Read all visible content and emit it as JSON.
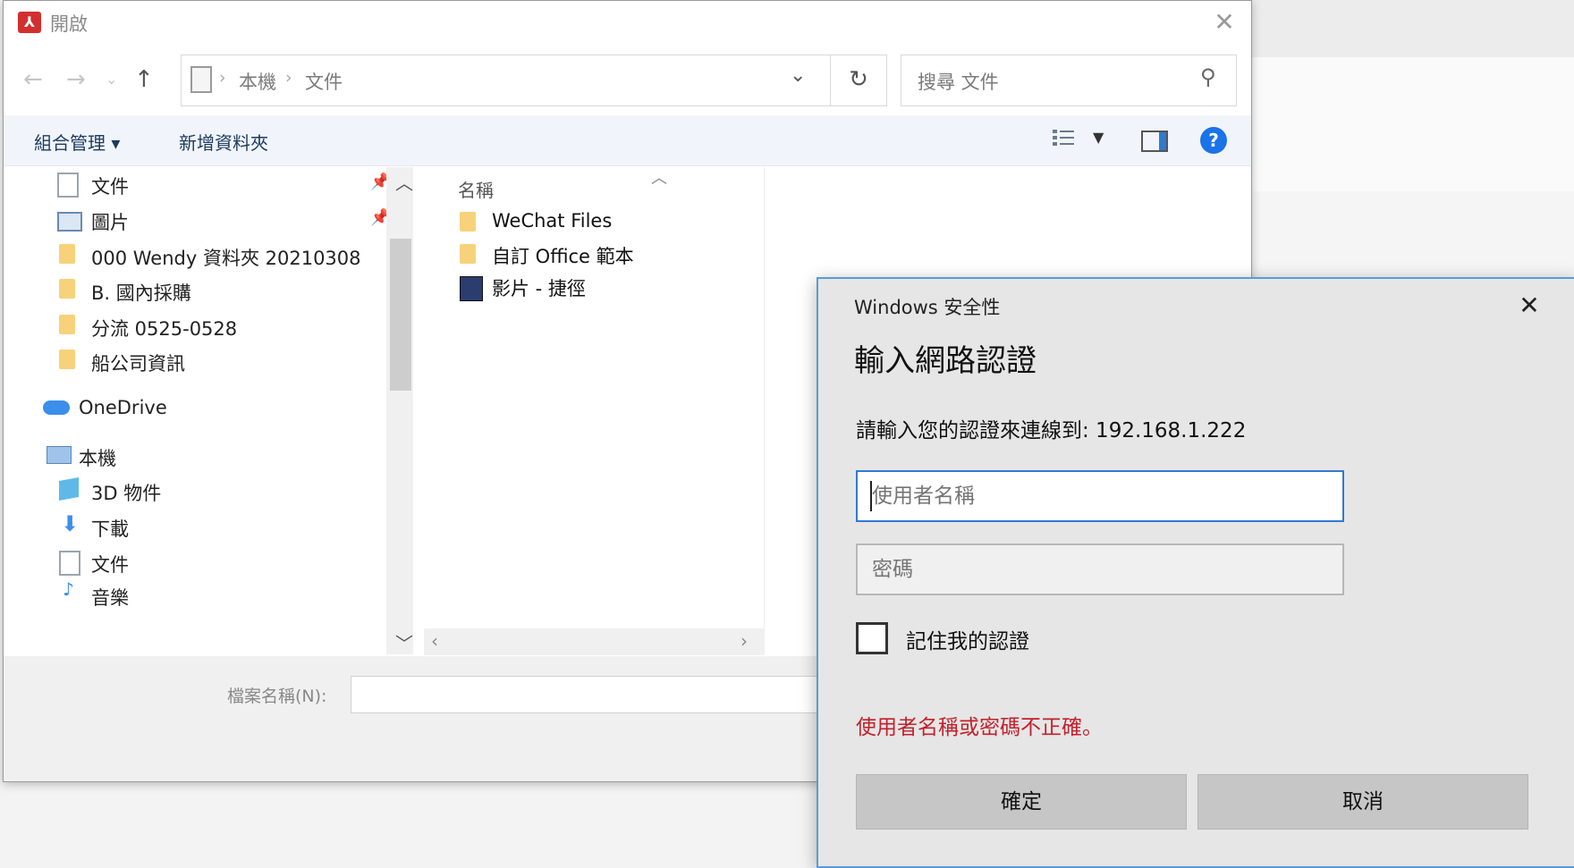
{
  "open_dialog": {
    "title": "開啟",
    "address": {
      "crumbs": [
        "本機",
        "文件"
      ],
      "separator": "›"
    },
    "search_placeholder": "搜尋 文件",
    "toolbar": {
      "organize": "組合管理 ▾",
      "new_folder": "新增資料夾"
    },
    "nav_items": [
      {
        "label": "文件",
        "icon": "document-icon",
        "pinned": true
      },
      {
        "label": "圖片",
        "icon": "pictures-icon",
        "pinned": true
      },
      {
        "label": "000 Wendy 資料夾 20210308",
        "icon": "folder-icon"
      },
      {
        "label": "B. 國內採購",
        "icon": "folder-icon"
      },
      {
        "label": "分流 0525-0528",
        "icon": "folder-icon"
      },
      {
        "label": "船公司資訊",
        "icon": "folder-icon"
      },
      {
        "label": "OneDrive",
        "icon": "cloud-icon"
      },
      {
        "label": "本機",
        "icon": "computer-icon"
      },
      {
        "label": "3D 物件",
        "icon": "cube-icon"
      },
      {
        "label": "下載",
        "icon": "download-icon"
      },
      {
        "label": "文件",
        "icon": "document-icon"
      },
      {
        "label": "音樂",
        "icon": "music-icon"
      }
    ],
    "file_list": {
      "column_name": "名稱",
      "items": [
        {
          "label": "WeChat Files",
          "icon": "folder-icon"
        },
        {
          "label": "自訂 Office 範本",
          "icon": "folder-icon"
        },
        {
          "label": "影片 - 捷徑",
          "icon": "video-shortcut-icon"
        }
      ]
    },
    "filename_label": "檔案名稱(N):",
    "filename_value": ""
  },
  "security_dialog": {
    "title": "Windows 安全性",
    "heading": "輸入網路認證",
    "description": "請輸入您的認證來連線到: 192.168.1.222",
    "username_placeholder": "使用者名稱",
    "password_placeholder": "密碼",
    "remember_label": "記住我的認證",
    "remember_checked": false,
    "error": "使用者名稱或密碼不正確。",
    "ok_label": "確定",
    "cancel_label": "取消"
  },
  "colors": {
    "error": "#c3202c",
    "accent": "#2f7bd0",
    "help": "#1a73e8"
  }
}
